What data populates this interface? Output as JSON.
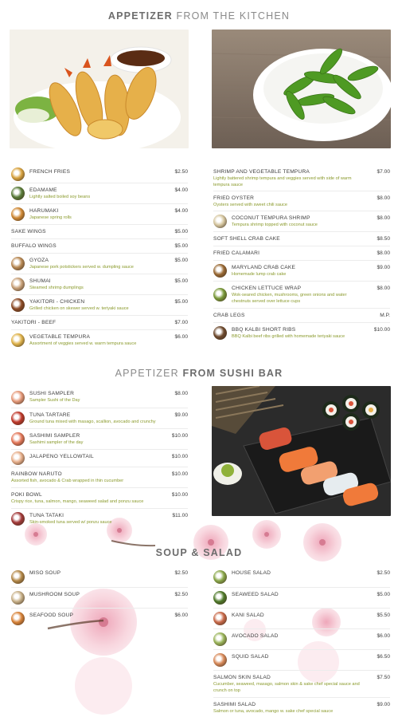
{
  "sections": {
    "kitchen": {
      "title_bold": "APPETIZER",
      "title_rest": " FROM THE KITCHEN"
    },
    "sushi": {
      "title_rest": "APPETIZER ",
      "title_bold": "FROM SUSHI BAR"
    },
    "soup": {
      "title": "SOUP & SALAD"
    }
  },
  "kitchen_left": [
    {
      "name": "FRENCH FRIES",
      "desc": "",
      "price": "$2.50",
      "icon": "fries-icon",
      "color": "#d9a441"
    },
    {
      "name": "EDAMAME",
      "desc": "Lightly salted boiled soy beans",
      "price": "$4.00",
      "icon": "edamame-icon",
      "color": "#5a7d3a"
    },
    {
      "name": "HARUMAKI",
      "desc": "Japanese spring rolls",
      "price": "$4.00",
      "icon": "spring-roll-icon",
      "color": "#d08a36"
    },
    {
      "name": "SAKE WINGS",
      "desc": "",
      "price": "$5.00",
      "icon": "",
      "color": ""
    },
    {
      "name": "BUFFALO WINGS",
      "desc": "",
      "price": "$5.00",
      "icon": "",
      "color": ""
    },
    {
      "name": "GYOZA",
      "desc": "Japanese pork potstickers served w. dumpling sauce",
      "price": "$5.00",
      "icon": "gyoza-icon",
      "color": "#b98a55"
    },
    {
      "name": "SHUMAI",
      "desc": "Steamed shrimp dumplings",
      "price": "$5.00",
      "icon": "shumai-icon",
      "color": "#c9a27a"
    },
    {
      "name": "YAKITORI - CHICKEN",
      "desc": "Grilled chicken on skewer served w. teriyaki sauce",
      "price": "$5.00",
      "icon": "yakitori-icon",
      "color": "#8c4a25"
    },
    {
      "name": "YAKITORI - BEEF",
      "desc": "",
      "price": "$7.00",
      "icon": "",
      "color": ""
    },
    {
      "name": "VEGETABLE TEMPURA",
      "desc": "Assortment of veggies served w. warm tempura sauce",
      "price": "$6.00",
      "icon": "tempura-icon",
      "color": "#e0b44c"
    }
  ],
  "kitchen_right": [
    {
      "name": "SHRIMP AND VEGETABLE TEMPURA",
      "desc": "Lightly battered shrimp tempura and veggies served with side of warm tempura sauce",
      "price": "$7.00",
      "icon": "",
      "color": ""
    },
    {
      "name": "FRIED OYSTER",
      "desc": "Oysters served with sweet chili sauce",
      "price": "$8.00",
      "icon": "",
      "color": ""
    },
    {
      "name": "COCONUT TEMPURA SHRIMP",
      "desc": "Tempura shrimp topped with coconut sauce",
      "price": "$8.00",
      "icon": "coconut-shrimp-icon",
      "color": "#d6c7a0"
    },
    {
      "name": "SOFT SHELL CRAB CAKE",
      "desc": "",
      "price": "$8.50",
      "icon": "",
      "color": ""
    },
    {
      "name": "FRIED CALAMARI",
      "desc": "",
      "price": "$8.00",
      "icon": "",
      "color": ""
    },
    {
      "name": "MARYLAND CRAB CAKE",
      "desc": "Homemade lump crab cake",
      "price": "$9.00",
      "icon": "crab-cake-icon",
      "color": "#9a6a35"
    },
    {
      "name": "CHICKEN LETTUCE WRAP",
      "desc": "Wok-seared chicken, mushrooms, green onions and water chestnuts served over lettuce cups",
      "price": "$8.00",
      "icon": "lettuce-wrap-icon",
      "color": "#7a9a3a"
    },
    {
      "name": "CRAB LEGS",
      "desc": "",
      "price": "M.P.",
      "icon": "",
      "color": ""
    },
    {
      "name": "BBQ KALBI SHORT RIBS",
      "desc": "BBQ Kalbi beef ribs grilled with homemade teriyaki sauce",
      "price": "$10.00",
      "icon": "short-ribs-icon",
      "color": "#6e4a2e"
    }
  ],
  "sushi_items": [
    {
      "name": "SUSHI SAMPLER",
      "desc": "Sampler Sushi of the Day",
      "price": "$8.00",
      "icon": "sushi-sampler-icon",
      "color": "#e69a7a"
    },
    {
      "name": "TUNA TARTARE",
      "desc": "Ground tuna mixed with masago, scallion, avocado and crunchy",
      "price": "$9.00",
      "icon": "tuna-tartare-icon",
      "color": "#c0392b"
    },
    {
      "name": "SASHIMI SAMPLER",
      "desc": "Sashimi sampler of the day",
      "price": "$10.00",
      "icon": "sashimi-icon",
      "color": "#e4785a"
    },
    {
      "name": "JALAPENO YELLOWTAIL",
      "desc": "",
      "price": "$10.00",
      "icon": "yellowtail-icon",
      "color": "#e8b08c"
    },
    {
      "name": "RAINBOW NARUTO",
      "desc": "Assorted fish, avocado & Crab wrapped in thin cucumber",
      "price": "$10.00",
      "icon": "",
      "color": ""
    },
    {
      "name": "POKI BOWL",
      "desc": "Crispy rice, tuna, salmon, mango, seaweed salad and ponzu sauce",
      "price": "$10.00",
      "icon": "",
      "color": ""
    },
    {
      "name": "TUNA TATAKI",
      "desc": "Skin-smoked tuna served w/ ponzu sauce",
      "price": "$11.00",
      "icon": "tuna-tataki-icon",
      "color": "#a33a3a"
    }
  ],
  "soup_items": [
    {
      "name": "MISO SOUP",
      "desc": "",
      "price": "$2.50",
      "icon": "miso-soup-icon",
      "color": "#b58a4a"
    },
    {
      "name": "MUSHROOM SOUP",
      "desc": "",
      "price": "$2.50",
      "icon": "mushroom-soup-icon",
      "color": "#c9b28a"
    },
    {
      "name": "SEAFOOD SOUP",
      "desc": "",
      "price": "$6.00",
      "icon": "seafood-soup-icon",
      "color": "#d9843a"
    }
  ],
  "salad_items": [
    {
      "name": "HOUSE SALAD",
      "desc": "",
      "price": "$2.50",
      "icon": "house-salad-icon",
      "color": "#8aa84a"
    },
    {
      "name": "SEAWEED SALAD",
      "desc": "",
      "price": "$5.00",
      "icon": "seaweed-salad-icon",
      "color": "#4f7a2a"
    },
    {
      "name": "KANI SALAD",
      "desc": "",
      "price": "$5.50",
      "icon": "kani-salad-icon",
      "color": "#c96a4a"
    },
    {
      "name": "AVOCADO SALAD",
      "desc": "",
      "price": "$6.00",
      "icon": "avocado-salad-icon",
      "color": "#9ab55a"
    },
    {
      "name": "SQUID SALAD",
      "desc": "",
      "price": "$6.50",
      "icon": "squid-salad-icon",
      "color": "#d88a5a"
    },
    {
      "name": "SALMON SKIN SALAD",
      "desc": "Cucumber, seaweed, masago, salmon skin & sake chef special sauce and crunch on top",
      "price": "$7.50",
      "icon": "",
      "color": ""
    },
    {
      "name": "SASHIMI SALAD",
      "desc": "Salmon or tuna, avocado, mango w. sake chef special sauce",
      "price": "$9.00",
      "icon": "",
      "color": ""
    }
  ],
  "colors": {
    "desc": "#8a9a2c",
    "blossom": "#f2b8c6",
    "blossom_center": "#c9506e"
  }
}
